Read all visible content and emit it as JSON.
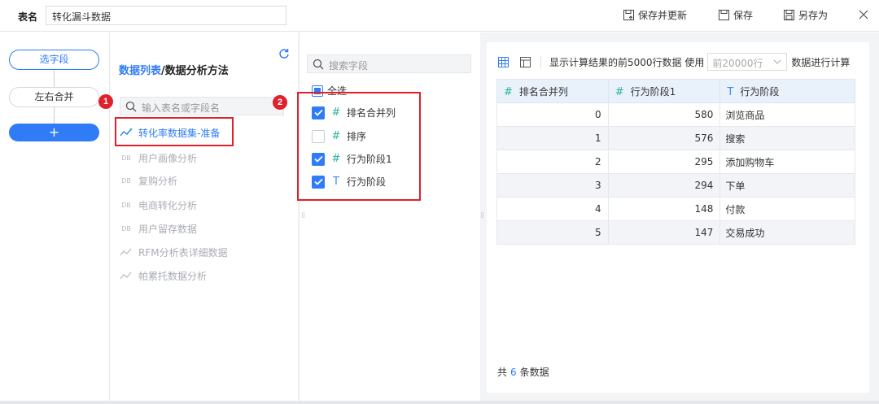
{
  "topbar": {
    "name_label": "表名",
    "table_name": "转化漏斗数据",
    "save_update_label": "保存并更新",
    "save_label": "保存",
    "save_as_label": "另存为"
  },
  "steps": {
    "select_fields": "选字段",
    "merge": "左右合并",
    "add": "+"
  },
  "data_panel": {
    "title_part1": "数据列表",
    "title_sep": "/",
    "title_part2": "数据分析方法",
    "search_placeholder": "输入表名或字段名",
    "items": [
      {
        "label": "转化率数据集-准备",
        "icon": "dataset-icon",
        "state": "active"
      },
      {
        "label": "用户画像分析",
        "icon": "db-icon",
        "state": "disabled"
      },
      {
        "label": "复购分析",
        "icon": "db-icon",
        "state": "disabled"
      },
      {
        "label": "电商转化分析",
        "icon": "db-icon",
        "state": "disabled"
      },
      {
        "label": "用户留存数据",
        "icon": "db-icon",
        "state": "disabled"
      },
      {
        "label": "RFM分析表详细数据",
        "icon": "dataset-icon",
        "state": "disabled"
      },
      {
        "label": "帕累托数据分析",
        "icon": "dataset-icon",
        "state": "disabled"
      }
    ],
    "db_icon_text": "DB"
  },
  "fields_panel": {
    "search_placeholder": "搜索字段",
    "select_all": "全选",
    "fields": [
      {
        "label": "排名合并列",
        "type": "#",
        "checked": true
      },
      {
        "label": "排序",
        "type": "#",
        "checked": false
      },
      {
        "label": "行为阶段1",
        "type": "#",
        "checked": true
      },
      {
        "label": "行为阶段",
        "type": "T",
        "checked": true
      }
    ]
  },
  "preview": {
    "text_before": "显示计算结果的前5000行数据 使用",
    "row_select_placeholder": "前20000行",
    "text_after": "数据进行计算",
    "columns": [
      {
        "type": "#",
        "label": "排名合并列"
      },
      {
        "type": "#",
        "label": "行为阶段1"
      },
      {
        "type": "T",
        "label": "行为阶段"
      }
    ],
    "rows": [
      [
        "0",
        "580",
        "浏览商品"
      ],
      [
        "1",
        "576",
        "搜索"
      ],
      [
        "2",
        "295",
        "添加购物车"
      ],
      [
        "3",
        "294",
        "下单"
      ],
      [
        "4",
        "148",
        "付款"
      ],
      [
        "5",
        "147",
        "交易成功"
      ]
    ],
    "total_prefix": "共",
    "total_count": "6",
    "total_suffix": "条数据"
  },
  "annotations": {
    "badge1": "1",
    "badge2": "2",
    "color": "#e0202a"
  },
  "colors": {
    "accent": "#2f7cf6",
    "numeric_field": "#2fb4a0",
    "header_bg": "#e9f1fb"
  }
}
